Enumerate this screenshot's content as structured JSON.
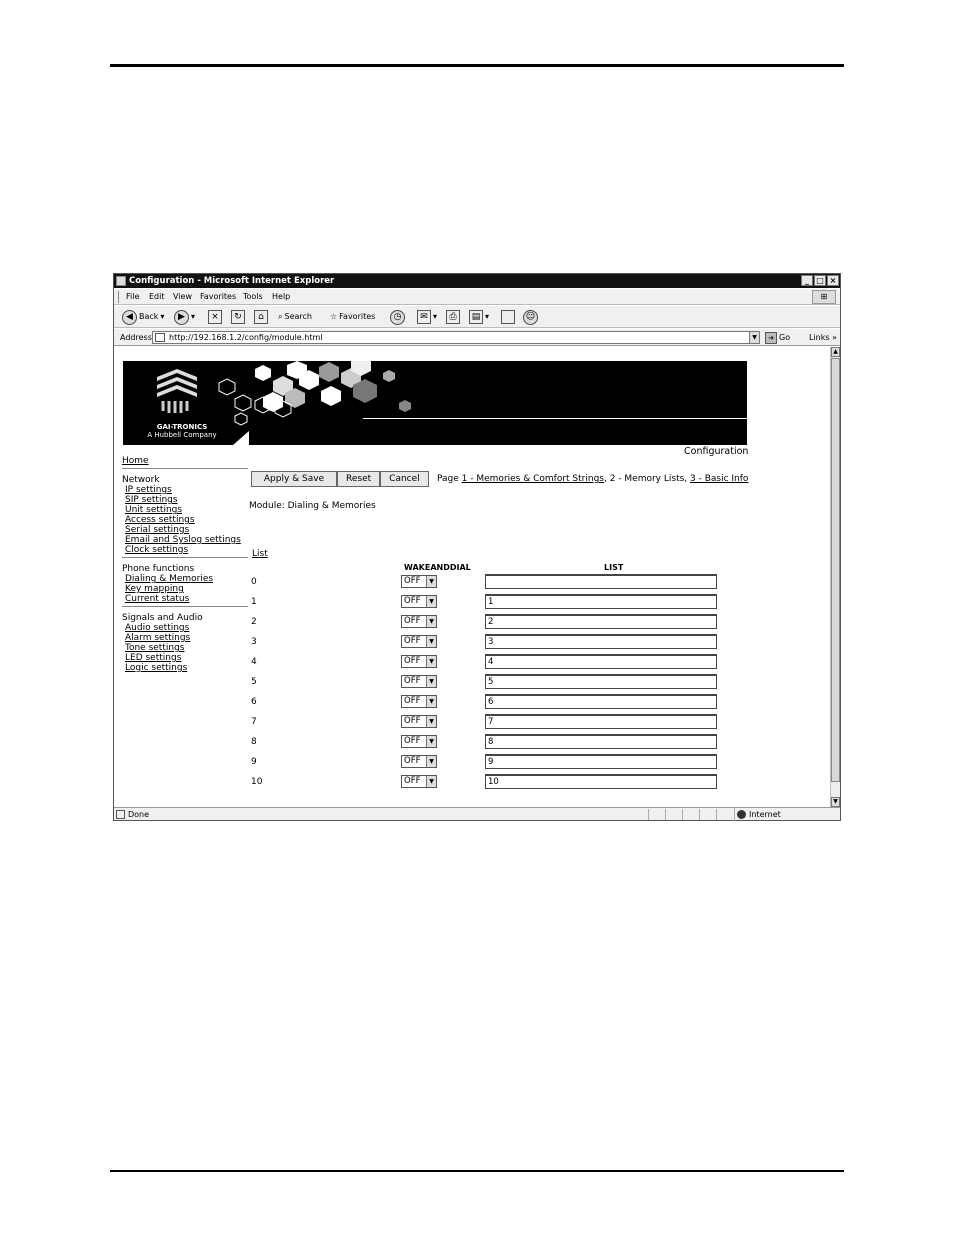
{
  "window": {
    "title": "Configuration - Microsoft Internet Explorer",
    "controls": [
      "_",
      "□",
      "×"
    ]
  },
  "menu": [
    "File",
    "Edit",
    "View",
    "Favorites",
    "Tools",
    "Help"
  ],
  "toolbar": {
    "back": "Back",
    "search": "Search",
    "favorites": "Favorites"
  },
  "address": {
    "label": "Address",
    "url": "http://192.168.1.2/config/module.html",
    "go": "Go",
    "links": "Links"
  },
  "status": {
    "text": "Done",
    "zone": "Internet"
  },
  "brand": {
    "name": "GAI-TRONICS",
    "tagline": "A Hubbell Company"
  },
  "page": {
    "config_label": "Configuration",
    "buttons": {
      "apply": "Apply & Save",
      "reset": "Reset",
      "cancel": "Cancel"
    },
    "pagenav": {
      "prefix": "Page",
      "link1": "1 - Memories & Comfort Strings",
      "current": ", 2 - Memory Lists, ",
      "link3": "3 - Basic Info"
    },
    "module": "Module: Dialing & Memories",
    "list_link": "List",
    "col_wake": "WAKEANDDIAL",
    "col_list": "LIST"
  },
  "nav": {
    "home": "Home",
    "network": {
      "title": "Network",
      "items": [
        "IP settings",
        "SIP settings",
        "Unit settings",
        "Access settings",
        "Serial settings",
        "Email and Syslog settings",
        "Clock settings"
      ]
    },
    "phone": {
      "title": "Phone functions",
      "items": [
        "Dialing & Memories",
        "Key mapping",
        "Current status"
      ]
    },
    "signals": {
      "title": "Signals and Audio",
      "items": [
        "Audio settings",
        "Alarm settings",
        "Tone settings",
        "LED settings",
        "Logic settings"
      ]
    }
  },
  "rows": [
    {
      "num": "0",
      "wake": "OFF",
      "list": ""
    },
    {
      "num": "1",
      "wake": "OFF",
      "list": "1"
    },
    {
      "num": "2",
      "wake": "OFF",
      "list": "2"
    },
    {
      "num": "3",
      "wake": "OFF",
      "list": "3"
    },
    {
      "num": "4",
      "wake": "OFF",
      "list": "4"
    },
    {
      "num": "5",
      "wake": "OFF",
      "list": "5"
    },
    {
      "num": "6",
      "wake": "OFF",
      "list": "6"
    },
    {
      "num": "7",
      "wake": "OFF",
      "list": "7"
    },
    {
      "num": "8",
      "wake": "OFF",
      "list": "8"
    },
    {
      "num": "9",
      "wake": "OFF",
      "list": "9"
    },
    {
      "num": "10",
      "wake": "OFF",
      "list": "10"
    }
  ]
}
